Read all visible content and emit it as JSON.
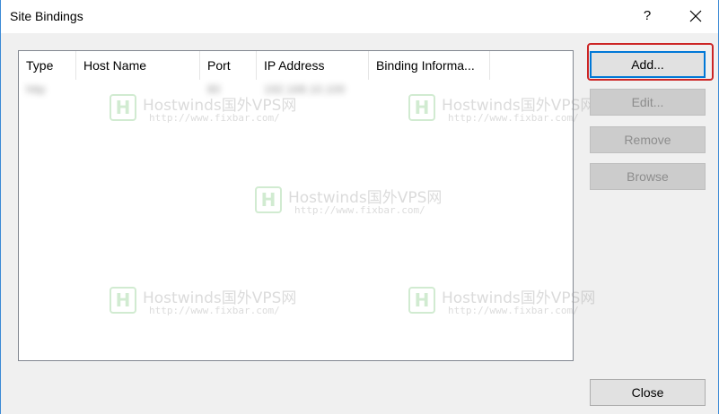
{
  "window": {
    "title": "Site Bindings",
    "help_label": "?"
  },
  "bindings_list": {
    "columns": [
      "Type",
      "Host Name",
      "Port",
      "IP Address",
      "Binding Informa..."
    ],
    "rows": [
      {
        "type": "http",
        "host_name": "",
        "port": "80",
        "ip_address": "192.168.10.100",
        "binding_info": ""
      }
    ]
  },
  "buttons": {
    "add": "Add...",
    "edit": "Edit...",
    "remove": "Remove",
    "browse": "Browse",
    "close": "Close"
  },
  "watermark": {
    "title": "Hostwinds国外VPS网",
    "url": "http://www.fixbar.com/",
    "logo_letter": "H"
  },
  "colors": {
    "highlight": "#cc2525",
    "accent": "#0078d7"
  }
}
